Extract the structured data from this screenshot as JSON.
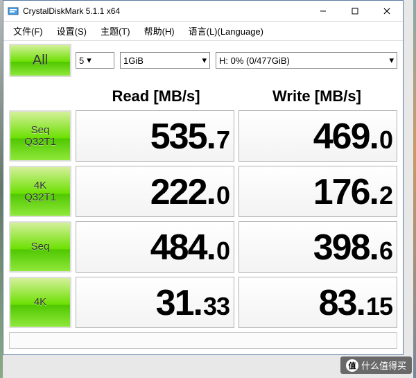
{
  "titlebar": {
    "title": "CrystalDiskMark 5.1.1 x64"
  },
  "menu": {
    "file": "文件(F)",
    "settings": "设置(S)",
    "theme": "主题(T)",
    "help": "帮助(H)",
    "language": "语言(L)(Language)"
  },
  "toolbar": {
    "runs": "5",
    "size": "1GiB",
    "drive": "H: 0% (0/477GiB)",
    "all_label": "All"
  },
  "headers": {
    "read": "Read [MB/s]",
    "write": "Write [MB/s]"
  },
  "tests": [
    {
      "name": "Seq Q32T1",
      "line1": "Seq",
      "line2": "Q32T1",
      "read_big": "535",
      "read_sm": "7",
      "write_big": "469",
      "write_sm": "0"
    },
    {
      "name": "4K Q32T1",
      "line1": "4K",
      "line2": "Q32T1",
      "read_big": "222",
      "read_sm": "0",
      "write_big": "176",
      "write_sm": "2"
    },
    {
      "name": "Seq",
      "line1": "Seq",
      "line2": "",
      "read_big": "484",
      "read_sm": "0",
      "write_big": "398",
      "write_sm": "6"
    },
    {
      "name": "4K",
      "line1": "4K",
      "line2": "",
      "read_big": "31",
      "read_sm": "33",
      "write_big": "83",
      "write_sm": "15"
    }
  ],
  "watermark": {
    "char": "值",
    "text": "什么值得买"
  },
  "chart_data": {
    "type": "table",
    "title": "CrystalDiskMark 5.1.1 x64 — H: 0% (0/477GiB), 5 runs, 1GiB",
    "columns": [
      "Test",
      "Read [MB/s]",
      "Write [MB/s]"
    ],
    "rows": [
      [
        "Seq Q32T1",
        535.7,
        469.0
      ],
      [
        "4K Q32T1",
        222.0,
        176.2
      ],
      [
        "Seq",
        484.0,
        398.6
      ],
      [
        "4K",
        31.33,
        83.15
      ]
    ]
  }
}
